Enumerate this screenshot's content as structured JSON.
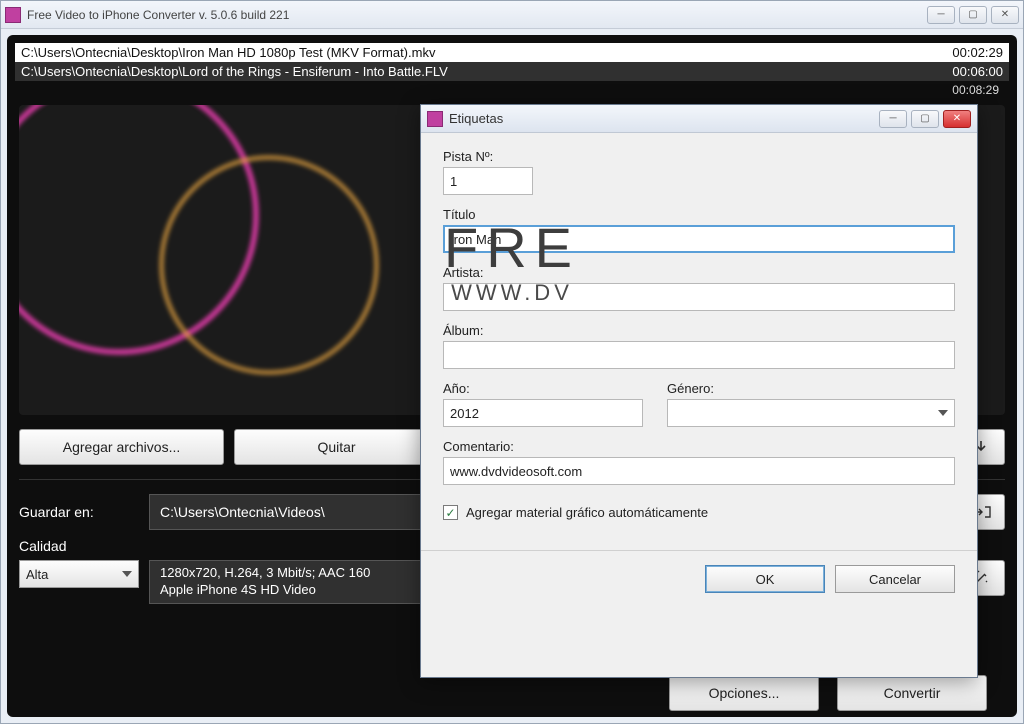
{
  "main_window": {
    "title": "Free Video to iPhone Converter  v. 5.0.6 build 221"
  },
  "files": [
    {
      "path": "C:\\Users\\Ontecnia\\Desktop\\Iron Man HD 1080p Test (MKV Format).mkv",
      "duration": "00:02:29"
    },
    {
      "path": "C:\\Users\\Ontecnia\\Desktop\\Lord of the Rings - Ensiferum - Into Battle.FLV",
      "duration": "00:06:00"
    }
  ],
  "total_duration": "00:08:29",
  "brand": {
    "big": "FRE",
    "sub": "WWW.DV"
  },
  "toolbar": {
    "add_files": "Agregar archivos...",
    "remove": "Quitar"
  },
  "save": {
    "label": "Guardar en:",
    "path": "C:\\Users\\Ontecnia\\Videos\\"
  },
  "quality": {
    "label": "Calidad",
    "selected": "Alta",
    "info_line1": "1280x720, H.264, 3 Mbit/s; AAC 160",
    "info_line2": "Apple iPhone 4S HD Video"
  },
  "bottom": {
    "options": "Opciones...",
    "convert": "Convertir"
  },
  "dialog": {
    "title": "Etiquetas",
    "track_label": "Pista Nº:",
    "track_value": "1",
    "title_label": "Título",
    "title_value": "Iron Man",
    "artist_label": "Artista:",
    "artist_value": "",
    "album_label": "Álbum:",
    "album_value": "",
    "year_label": "Año:",
    "year_value": "2012",
    "genre_label": "Género:",
    "genre_value": "",
    "comment_label": "Comentario:",
    "comment_value": "www.dvdvideosoft.com",
    "checkbox_label": "Agregar material gráfico automáticamente",
    "checkbox_checked": true,
    "ok": "OK",
    "cancel": "Cancelar"
  }
}
